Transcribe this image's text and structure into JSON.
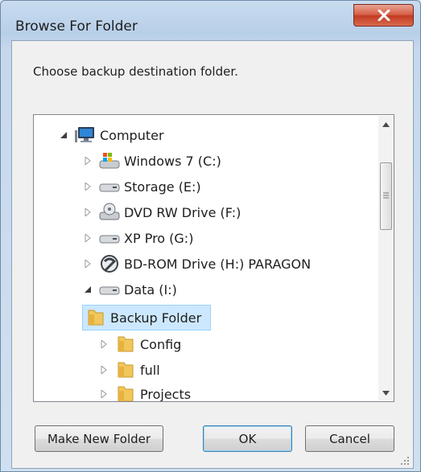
{
  "window": {
    "title": "Browse For Folder"
  },
  "prompt": "Choose backup destination folder.",
  "tree": {
    "root": {
      "label": "Computer",
      "icon": "computer-icon"
    },
    "items": [
      {
        "label": "Windows 7 (C:)",
        "icon": "system-drive-icon"
      },
      {
        "label": "Storage (E:)",
        "icon": "hard-drive-icon"
      },
      {
        "label": "DVD RW Drive (F:)",
        "icon": "dvd-drive-icon"
      },
      {
        "label": "XP Pro (G:)",
        "icon": "hard-drive-icon"
      },
      {
        "label": "BD-ROM Drive (H:) PARAGON",
        "icon": "paragon-disc-icon"
      },
      {
        "label": "Data (I:)",
        "icon": "hard-drive-icon"
      }
    ],
    "folders": [
      {
        "label": "Backup Folder",
        "selected": true
      },
      {
        "label": "Config"
      },
      {
        "label": "full"
      },
      {
        "label": "Projects"
      }
    ]
  },
  "buttons": {
    "make_new_folder": "Make New Folder",
    "ok": "OK",
    "cancel": "Cancel"
  },
  "colors": {
    "selection": "#cce8ff",
    "selection_border": "#99d1ff",
    "close_button": "#c7432b"
  }
}
